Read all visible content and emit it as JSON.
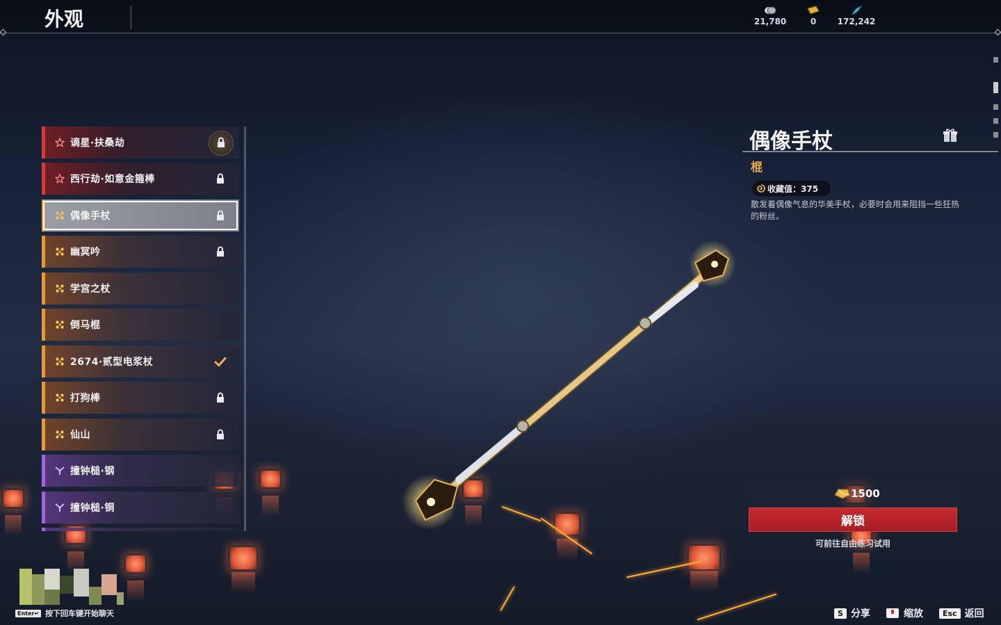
{
  "header": {
    "title": "外观",
    "currencies": [
      {
        "icon": "coin-stack-icon",
        "value": "21,780"
      },
      {
        "icon": "ticket-icon",
        "value": "0"
      },
      {
        "icon": "feather-gem-icon",
        "value": "172,242"
      }
    ]
  },
  "list": {
    "items": [
      {
        "label": "谪星·扶桑劫",
        "rarity": "red",
        "state": "locked-seal"
      },
      {
        "label": "西行劫·如意金箍棒",
        "rarity": "red",
        "state": "locked"
      },
      {
        "label": "偶像手杖",
        "rarity": "orange",
        "state": "locked",
        "selected": true
      },
      {
        "label": "幽冥吟",
        "rarity": "orange",
        "state": "locked"
      },
      {
        "label": "学宫之杖",
        "rarity": "orange",
        "state": "none"
      },
      {
        "label": "倒马棍",
        "rarity": "orange",
        "state": "none"
      },
      {
        "label": "2674·贰型电浆杖",
        "rarity": "orange",
        "state": "equipped"
      },
      {
        "label": "打狗棒",
        "rarity": "orange",
        "state": "locked"
      },
      {
        "label": "仙山",
        "rarity": "orange",
        "state": "locked"
      },
      {
        "label": "撞钟槌·钢",
        "rarity": "purple",
        "state": "none"
      },
      {
        "label": "撞钟槌·铜",
        "rarity": "purple",
        "state": "none"
      }
    ]
  },
  "detail": {
    "name": "偶像手杖",
    "category": "棍",
    "collect_label": "收藏值：375",
    "description": "散发着偶像气息的华美手杖，必要时会用来阻挡一些狂热的粉丝。",
    "price": "1500",
    "unlock_label": "解锁",
    "trial_note": "可前往自由练习试用"
  },
  "footer": {
    "chat_key": "Enter↵",
    "chat_hint": "按下回车键开始聊天",
    "share_key": "S",
    "share_label": "分享",
    "zoom_label": "缩放",
    "back_key": "Esc",
    "back_label": "返回"
  },
  "colors": {
    "rarity_red": "#d23a3e",
    "rarity_orange": "#e49a3a",
    "rarity_purple": "#9a66d8",
    "unlock_button": "#c42a2e",
    "category_text": "#e5a84a"
  }
}
